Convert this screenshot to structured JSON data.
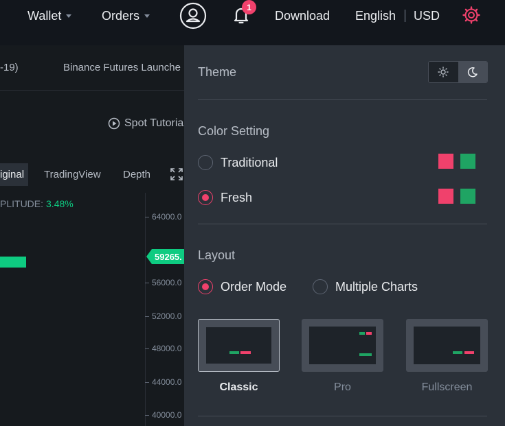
{
  "nav": {
    "wallet": "Wallet",
    "orders": "Orders",
    "notification_count": "1",
    "download": "Download",
    "language": "English",
    "currency": "USD"
  },
  "background": {
    "ticker_left": "-19)",
    "ticker_announcement": "Binance Futures Launche",
    "spot_tutorial": "Spot Tutoria",
    "tabs": [
      "iginal",
      "TradingView",
      "Depth"
    ],
    "amplitude_label": "PLITUDE:",
    "amplitude_value": "3.48%",
    "price_axis": [
      "64000.0",
      "56000.0",
      "52000.0",
      "48000.0",
      "44000.0",
      "40000.0"
    ],
    "current_price": "59265."
  },
  "settings": {
    "theme_title": "Theme",
    "theme_selected": "dark",
    "color_setting_title": "Color Setting",
    "color_options": [
      {
        "label": "Traditional",
        "selected": false,
        "up": "#f0416c",
        "down": "#1fa463"
      },
      {
        "label": "Fresh",
        "selected": true,
        "up": "#f0416c",
        "down": "#1fa463"
      }
    ],
    "layout_title": "Layout",
    "layout_modes": [
      {
        "label": "Order Mode",
        "selected": true
      },
      {
        "label": "Multiple Charts",
        "selected": false
      }
    ],
    "layouts": [
      {
        "label": "Classic",
        "selected": true
      },
      {
        "label": "Pro",
        "selected": false
      },
      {
        "label": "Fullscreen",
        "selected": false
      }
    ]
  },
  "colors": {
    "accent": "#f0416c",
    "green": "#0ecb81",
    "panel_bg": "#2b3139",
    "nav_bg": "#12161c"
  }
}
